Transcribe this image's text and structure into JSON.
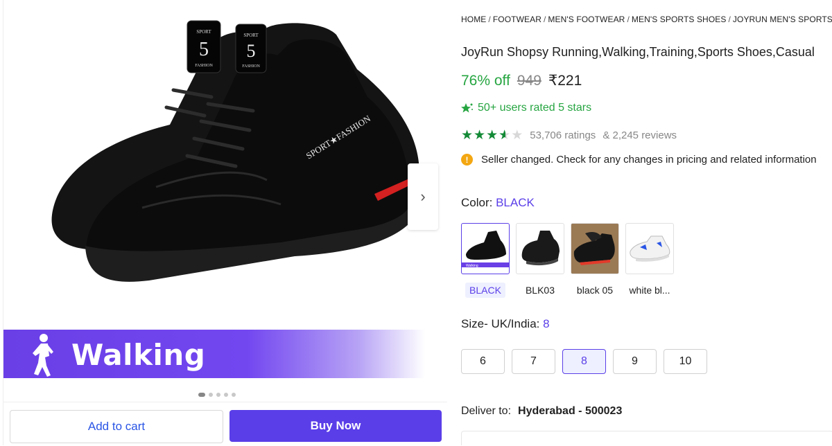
{
  "breadcrumb": [
    "HOME",
    "FOOTWEAR",
    "MEN'S FOOTWEAR",
    "MEN'S SPORTS SHOES",
    "JOYRUN MEN'S SPORTS SHOES"
  ],
  "product": {
    "title": "JoyRun Shopsy Running,Walking,Training,Sports Shoes,Casual",
    "discount": "76% off",
    "mrp": "949",
    "price": "₹221",
    "rated_text": "50+ users rated 5 stars",
    "rating_value": 3.5,
    "ratings_count": "53,706 ratings",
    "reviews_count": "& 2,245 reviews",
    "notice": "Seller changed. Check for any changes in pricing and related information"
  },
  "gallery": {
    "banner_text": "Walking",
    "brand_tongue_top": "SPORT",
    "brand_tongue_number": "5",
    "brand_tongue_bottom": "FASHION",
    "side_text": "SPORT★FASHION",
    "next_arrow": "›",
    "dot_count": 5,
    "active_dot": 0
  },
  "actions": {
    "add_to_cart": "Add to cart",
    "buy_now": "Buy Now"
  },
  "color": {
    "label": "Color:",
    "selected": "BLACK",
    "options": [
      "BLACK",
      "BLK03",
      "black 05",
      "white bl..."
    ],
    "thumb_tag": "Walking"
  },
  "size": {
    "label": "Size- UK/India:",
    "selected": "8",
    "options": [
      "6",
      "7",
      "8",
      "9",
      "10"
    ]
  },
  "delivery": {
    "label": "Deliver to:",
    "location": "Hyderabad - 500023"
  },
  "colors": {
    "accent": "#5a3ee8",
    "green": "#26a541",
    "star_green": "#138a36",
    "info_orange": "#f3a712"
  }
}
